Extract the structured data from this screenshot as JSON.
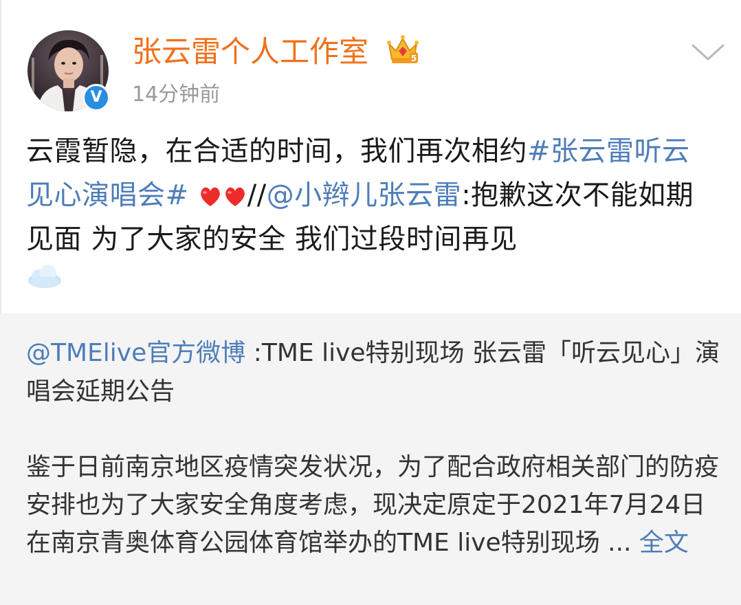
{
  "author": {
    "name": "张云雷个人工作室",
    "time": "14分钟前",
    "verified_mark": "V",
    "avatar_icon": "user-avatar",
    "badge_icon": "crown-icon",
    "brand_color": "#f0711b",
    "verified_color": "#2a8de0"
  },
  "post": {
    "text_1": "云霞暂隐，在合适的时间，我们再次相约",
    "hashtag": "#张云雷听云见心演唱会#",
    "separator": " ",
    "emoji": "heart-icon heart-icon",
    "repost_slashes": "//",
    "repost_user": "@小辫儿张云雷",
    "repost_text": ":抱歉这次不能如期见面 为了大家的安全 我们过段时间再见",
    "trailing_emoji": "cloud-icon",
    "link_color": "#4e7db8"
  },
  "quoted": {
    "user": "@TMElive官方微博",
    "title": " :TME live特别现场 张云雷「听云见心」演唱会延期公告",
    "body": "鉴于日前南京地区疫情突发状况，为了配合政府相关部门的防疫安排也为了大家安全角度考虑，现决定原定于2021年7月24日在南京青奥体育公园体育馆举办的TME live特别现场 ... ",
    "full_text_link": "全文"
  },
  "menu": {
    "dropdown_icon": "chevron-down-icon"
  }
}
